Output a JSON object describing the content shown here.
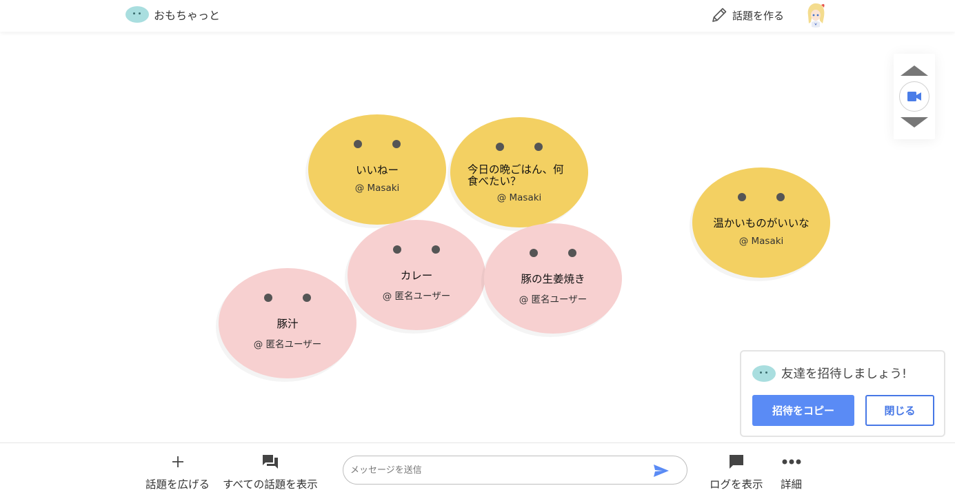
{
  "header": {
    "app_name": "おもちゃっと",
    "create_topic_label": "話題を作る"
  },
  "bubbles": [
    {
      "title": "いいねー",
      "user": "@ Masaki",
      "color": "#f3d062"
    },
    {
      "title": "今日の晩ごはん、何食べたい？",
      "user": "@ Masaki",
      "color": "#f3d062"
    },
    {
      "title": "温かいものがいいな",
      "user": "@ Masaki",
      "color": "#f3d062"
    },
    {
      "title": "カレー",
      "user": "@ 匿名ユーザー",
      "color": "#f7d0d0"
    },
    {
      "title": "豚の生姜焼き",
      "user": "@ 匿名ユーザー",
      "color": "#f7d0d0"
    },
    {
      "title": "豚汁",
      "user": "@ 匿名ユーザー",
      "color": "#f7d0d0"
    }
  ],
  "invite": {
    "message": "友達を招待しましょう!",
    "copy_label": "招待をコピー",
    "close_label": "閉じる"
  },
  "footer": {
    "expand_topic_label": "話題を広げる",
    "all_topics_label": "すべての話題を表示",
    "message_placeholder": "メッセージを送信",
    "show_log_label": "ログを表示",
    "details_label": "詳細"
  },
  "colors": {
    "accent": "#5a8bf5",
    "bubble_yellow": "#f3d062",
    "bubble_pink": "#f7d0d0",
    "logo_blob": "#a9dedf"
  },
  "icons": {
    "logo": "blob-icon",
    "create_topic": "pencil-icon",
    "camera": "video-camera-icon",
    "expand": "plus-icon",
    "all_topics": "forum-icon",
    "send": "send-icon",
    "log": "chat-bubble-icon",
    "details": "more-horizontal-icon"
  }
}
